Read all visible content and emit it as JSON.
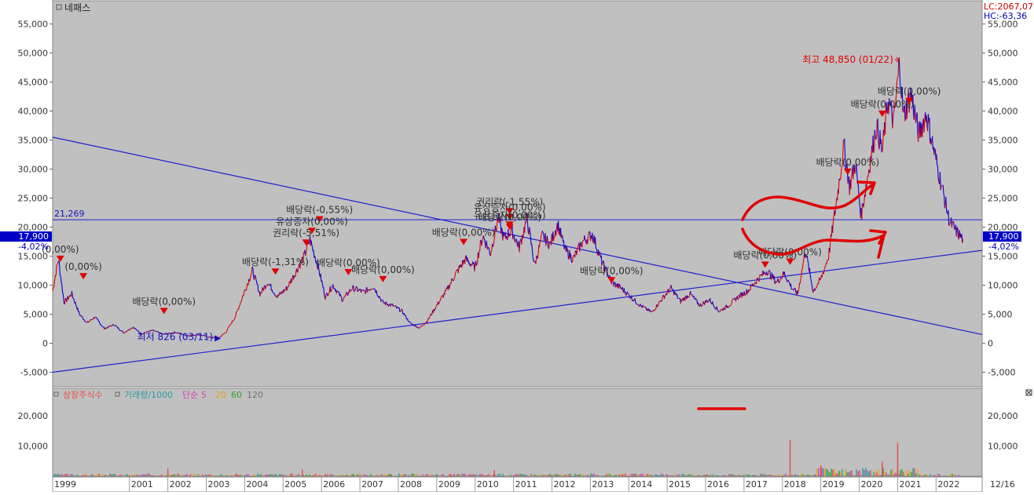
{
  "chart_data": [
    {
      "type": "line",
      "title": "네패스",
      "x_range": [
        1999,
        2023.2
      ],
      "ylim": [
        -7500,
        59000
      ],
      "y_ticks": [
        -5000,
        0,
        5000,
        10000,
        15000,
        20000,
        25000,
        30000,
        35000,
        40000,
        45000,
        50000,
        55000
      ],
      "y_tick_labels": [
        "-5,000",
        "0",
        "5,000",
        "10,000",
        "15,000",
        "20,000",
        "25,000",
        "30,000",
        "35,000",
        "40,000",
        "45,000",
        "50,000",
        "55,000"
      ],
      "x_ticks": [
        1999,
        2001,
        2002,
        2003,
        2004,
        2005,
        2006,
        2007,
        2008,
        2009,
        2010,
        2011,
        2012,
        2013,
        2014,
        2015,
        2016,
        2017,
        2018,
        2019,
        2020,
        2021,
        2022
      ],
      "x_tick_labels": [
        "1999",
        "2001",
        "2002",
        "2003",
        "2004",
        "2005",
        "2006",
        "2007",
        "2008",
        "2009",
        "2010",
        "2011",
        "2012",
        "2013",
        "2014",
        "2015",
        "2016",
        "2017",
        "2018",
        "2019",
        "2020",
        "2021",
        "2022"
      ],
      "series": [
        {
          "values": [
            [
              1999.0,
              9000
            ],
            [
              1999.15,
              14500
            ],
            [
              1999.3,
              7000
            ],
            [
              1999.5,
              8500
            ],
            [
              1999.7,
              5000
            ],
            [
              1999.9,
              3500
            ],
            [
              2000.1,
              4500
            ],
            [
              2000.35,
              2500
            ],
            [
              2000.6,
              3200
            ],
            [
              2000.85,
              1800
            ],
            [
              2001.1,
              2800
            ],
            [
              2001.3,
              1600
            ],
            [
              2001.6,
              2200
            ],
            [
              2001.9,
              1500
            ],
            [
              2002.2,
              1900
            ],
            [
              2002.5,
              1300
            ],
            [
              2002.8,
              1500
            ],
            [
              2003.1,
              1000
            ],
            [
              2003.3,
              826
            ],
            [
              2003.5,
              1800
            ],
            [
              2003.75,
              4500
            ],
            [
              2004.0,
              9000
            ],
            [
              2004.2,
              12500
            ],
            [
              2004.4,
              8500
            ],
            [
              2004.6,
              10500
            ],
            [
              2004.85,
              8000
            ],
            [
              2005.1,
              9500
            ],
            [
              2005.35,
              12500
            ],
            [
              2005.55,
              15000
            ],
            [
              2005.7,
              17800
            ],
            [
              2005.9,
              13500
            ],
            [
              2006.1,
              8000
            ],
            [
              2006.3,
              10000
            ],
            [
              2006.55,
              7500
            ],
            [
              2006.8,
              9500
            ],
            [
              2007.1,
              8800
            ],
            [
              2007.35,
              9800
            ],
            [
              2007.6,
              7000
            ],
            [
              2007.85,
              6500
            ],
            [
              2008.1,
              5500
            ],
            [
              2008.3,
              3500
            ],
            [
              2008.55,
              2600
            ],
            [
              2008.75,
              3800
            ],
            [
              2009.0,
              6500
            ],
            [
              2009.25,
              9000
            ],
            [
              2009.5,
              12000
            ],
            [
              2009.75,
              14500
            ],
            [
              2010.0,
              13000
            ],
            [
              2010.2,
              18500
            ],
            [
              2010.4,
              15500
            ],
            [
              2010.6,
              21500
            ],
            [
              2010.75,
              18000
            ],
            [
              2010.95,
              19500
            ],
            [
              2011.15,
              16500
            ],
            [
              2011.35,
              21500
            ],
            [
              2011.55,
              13500
            ],
            [
              2011.75,
              18500
            ],
            [
              2011.95,
              17000
            ],
            [
              2012.15,
              20500
            ],
            [
              2012.35,
              16000
            ],
            [
              2012.55,
              14500
            ],
            [
              2012.8,
              17500
            ],
            [
              2013.05,
              18800
            ],
            [
              2013.3,
              14000
            ],
            [
              2013.55,
              10500
            ],
            [
              2013.8,
              9500
            ],
            [
              2014.05,
              8000
            ],
            [
              2014.3,
              6500
            ],
            [
              2014.6,
              5300
            ],
            [
              2014.85,
              7500
            ],
            [
              2015.1,
              9500
            ],
            [
              2015.35,
              7200
            ],
            [
              2015.6,
              8500
            ],
            [
              2015.85,
              6500
            ],
            [
              2016.1,
              7500
            ],
            [
              2016.35,
              5500
            ],
            [
              2016.6,
              6500
            ],
            [
              2016.85,
              8000
            ],
            [
              2017.1,
              9000
            ],
            [
              2017.35,
              11000
            ],
            [
              2017.6,
              12500
            ],
            [
              2017.85,
              10500
            ],
            [
              2018.05,
              12000
            ],
            [
              2018.25,
              9500
            ],
            [
              2018.4,
              8500
            ],
            [
              2018.6,
              16000
            ],
            [
              2018.8,
              9000
            ],
            [
              2019.0,
              11000
            ],
            [
              2019.2,
              15000
            ],
            [
              2019.4,
              24000
            ],
            [
              2019.6,
              34000
            ],
            [
              2019.75,
              27000
            ],
            [
              2019.9,
              31000
            ],
            [
              2020.05,
              22000
            ],
            [
              2020.25,
              30000
            ],
            [
              2020.45,
              37500
            ],
            [
              2020.6,
              33000
            ],
            [
              2020.75,
              42000
            ],
            [
              2020.9,
              38000
            ],
            [
              2021.0,
              45000
            ],
            [
              2021.05,
              48850
            ],
            [
              2021.15,
              39000
            ],
            [
              2021.35,
              43000
            ],
            [
              2021.55,
              36000
            ],
            [
              2021.75,
              39500
            ],
            [
              2021.95,
              33000
            ],
            [
              2022.15,
              27000
            ],
            [
              2022.35,
              21000
            ],
            [
              2022.5,
              19500
            ],
            [
              2022.7,
              17900
            ]
          ]
        }
      ],
      "trend_lines": [
        {
          "from": [
            1999.0,
            35500
          ],
          "to": [
            2023.2,
            1500
          ]
        },
        {
          "from": [
            1999.0,
            -5000
          ],
          "to": [
            2023.2,
            16000
          ]
        }
      ],
      "horizontal_line": {
        "y": 21269,
        "label": "21,269"
      },
      "annotations": [
        {
          "x": 2021.05,
          "y": 48850,
          "text": "최고 48,850 (01/22)"
        },
        {
          "x": 2003.3,
          "y": 826,
          "text": "최저 826 (03/11)"
        },
        {
          "x": 2021.3,
          "y": 41200,
          "text": "배당락(0,00%)"
        },
        {
          "x": 2020.6,
          "y": 39000,
          "text": "배당락(0,00%)"
        },
        {
          "x": 2019.7,
          "y": 29000,
          "text": "배당락(0,00%)"
        },
        {
          "x": 2018.2,
          "y": 13500,
          "text": "배당락(0,00%)"
        },
        {
          "x": 2017.55,
          "y": 13000,
          "text": "배당락(0,00%)"
        },
        {
          "x": 2013.55,
          "y": 10300,
          "text": "배당락(0,00%)"
        },
        {
          "x": 2010.9,
          "y": 22200,
          "text": "권리락(-1,55%)"
        },
        {
          "x": 2010.9,
          "y": 21200,
          "text": "유상증자(0,00%)"
        },
        {
          "x": 2010.9,
          "y": 19900,
          "text": "유상증자(0,00%)"
        },
        {
          "x": 2010.9,
          "y": 19500,
          "text": "배당락(0,00%)"
        },
        {
          "x": 2009.7,
          "y": 16900,
          "text": "배당락(0,00%)"
        },
        {
          "x": 2005.95,
          "y": 20800,
          "text": "배당락(-0,55%)"
        },
        {
          "x": 2005.75,
          "y": 18800,
          "text": "유상증자(0,00%)"
        },
        {
          "x": 2005.6,
          "y": 16800,
          "text": "권리락(-5,51%)"
        },
        {
          "x": 2004.8,
          "y": 11800,
          "text": "배당락(-1,31%)"
        },
        {
          "x": 2006.7,
          "y": 11700,
          "text": "배당락(0,00%)"
        },
        {
          "x": 2007.6,
          "y": 10500,
          "text": "배당락(0,00%)"
        },
        {
          "x": 1999.2,
          "y": 14000,
          "text": "(0,00%)"
        },
        {
          "x": 1999.8,
          "y": 11000,
          "text": "(0,00%)"
        },
        {
          "x": 2001.9,
          "y": 5000,
          "text": "배당락(0,00%)"
        }
      ],
      "lc_label": "LC:2067,07",
      "hc_label": "HC:-63,36",
      "current_price_label": "17,900",
      "current_change_label": "-4,02%"
    },
    {
      "type": "bar",
      "y_ticks": [
        10000,
        20000
      ],
      "y_tick_labels": [
        "10,000",
        "20,000"
      ],
      "ylim": [
        0,
        29000
      ],
      "legend": [
        {
          "name": "상장주식수",
          "color": "#e84a4a"
        },
        {
          "name": "거래량/1000",
          "color": "#2a9aa0"
        },
        {
          "name": "단순 5",
          "color": "#d040b8"
        },
        {
          "name": "20",
          "color": "#e0a020"
        },
        {
          "name": "60",
          "color": "#30a030"
        },
        {
          "name": "120",
          "color": "#707070"
        }
      ],
      "spikes": [
        {
          "x": 2018.2,
          "value": 12000
        },
        {
          "x": 2019.0,
          "value": 3500
        },
        {
          "x": 2020.6,
          "value": 4800
        },
        {
          "x": 2021.0,
          "value": 11000
        },
        {
          "x": 2002.0,
          "value": 2500
        },
        {
          "x": 2005.5,
          "value": 2200
        },
        {
          "x": 2010.5,
          "value": 2000
        }
      ],
      "date_label": "12/16"
    }
  ],
  "colors": {
    "plot_bg": "#c0c0c0",
    "price_up": "#e00000",
    "price_down": "#0000e0",
    "trend": "#2020d0",
    "annotation_red": "#e00000",
    "annotation_text": "#303030",
    "axis_text": "#333333",
    "highlight_box": "#0000c8"
  }
}
